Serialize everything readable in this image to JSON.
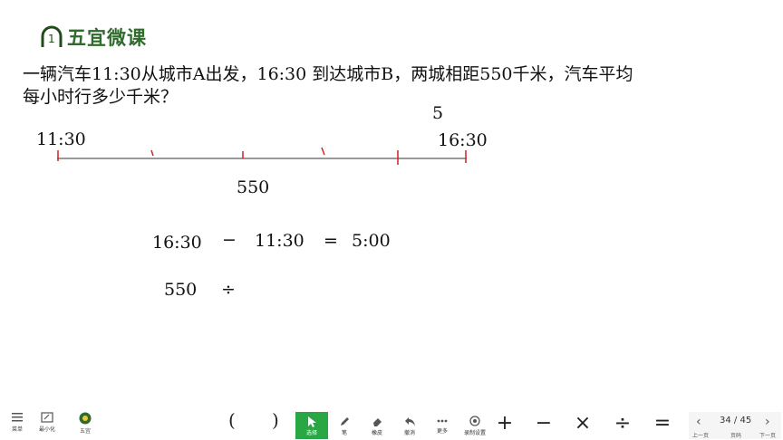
{
  "logo": {
    "number": "1",
    "text": "五宜微课"
  },
  "problem": {
    "line1": "一辆汽车11:30从城市A出发，16:30 到达城市B，两城相距550千米，汽车平均",
    "line2": "每小时行多少千米？"
  },
  "timeline": {
    "hours_label": "5",
    "start_label": "11:30",
    "end_label": "16:30",
    "distance_label": "550"
  },
  "work": {
    "row1": {
      "a": "16:30",
      "op1": "−",
      "b": "11:30",
      "op2": "=",
      "result": "5:00"
    },
    "row2": {
      "a": "550",
      "op1": "÷"
    }
  },
  "bottom_left": {
    "menu_label": "菜单",
    "minimize_label": "最小化",
    "app_label": "五宜"
  },
  "parens": {
    "open": "(",
    "close": ")"
  },
  "toolbar": {
    "items": [
      {
        "label": "选择",
        "icon": "cursor-icon"
      },
      {
        "label": "笔",
        "icon": "pen-icon"
      },
      {
        "label": "橡皮",
        "icon": "eraser-icon"
      },
      {
        "label": "撤消",
        "icon": "undo-icon"
      },
      {
        "label": "更多",
        "icon": "more-icon"
      },
      {
        "label": "录制设置",
        "icon": "record-icon"
      }
    ]
  },
  "operators": {
    "plus": "+",
    "minus": "−",
    "times": "×",
    "divide": "÷",
    "equals": "="
  },
  "pager": {
    "page": "34 / 45",
    "prev_label": "上一页",
    "page_label": "页码",
    "next_label": "下一页"
  },
  "colors": {
    "tick": "#d42020",
    "logo_green": "#2f6b2a",
    "active_green": "#29a745"
  }
}
